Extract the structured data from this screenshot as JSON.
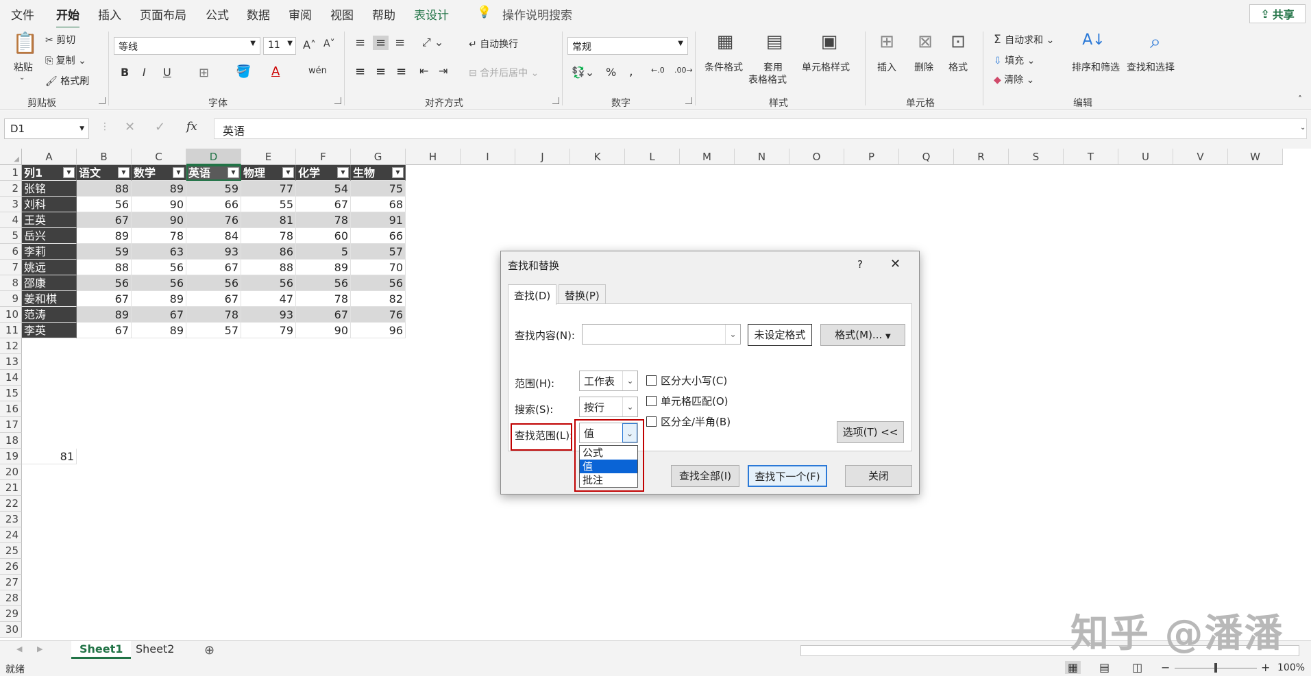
{
  "menu": {
    "tabs": [
      "文件",
      "开始",
      "插入",
      "页面布局",
      "公式",
      "数据",
      "审阅",
      "视图",
      "帮助",
      "表设计"
    ],
    "active_tab": "开始",
    "search": "操作说明搜索",
    "share": "共享"
  },
  "ribbon": {
    "clipboard": {
      "paste": "粘贴",
      "cut": "剪切",
      "copy": "复制",
      "format_painter": "格式刷",
      "label": "剪贴板"
    },
    "font": {
      "name": "等线",
      "size": "11",
      "bold": "B",
      "italic": "I",
      "underline": "U",
      "label": "字体"
    },
    "alignment": {
      "wrap": "自动换行",
      "merge": "合并后居中",
      "label": "对齐方式"
    },
    "number": {
      "format": "常规",
      "label": "数字"
    },
    "styles": {
      "conditional": "条件格式",
      "table_fmt_1": "套用",
      "table_fmt_2": "表格格式",
      "cell_styles": "单元格样式",
      "label": "样式"
    },
    "cells": {
      "insert": "插入",
      "delete": "删除",
      "format": "格式",
      "label": "单元格"
    },
    "editing": {
      "autosum": "自动求和",
      "fill": "填充",
      "clear": "清除",
      "sort": "排序和筛选",
      "find": "查找和选择",
      "label": "编辑"
    }
  },
  "formula_bar": {
    "name_box": "D1",
    "fx": "fx",
    "content": "英语"
  },
  "sheet": {
    "columns": [
      "A",
      "B",
      "C",
      "D",
      "E",
      "F",
      "G",
      "H",
      "I",
      "J",
      "K",
      "L",
      "M",
      "N",
      "O",
      "P",
      "Q",
      "R",
      "S",
      "T",
      "U",
      "V",
      "W"
    ],
    "selected_column": "D",
    "row_count": 30,
    "headers": [
      "列1",
      "语文",
      "数学",
      "英语",
      "物理",
      "化学",
      "生物"
    ],
    "rows": [
      [
        "张铭",
        "88",
        "89",
        "59",
        "77",
        "54",
        "75"
      ],
      [
        "刘科",
        "56",
        "90",
        "66",
        "55",
        "67",
        "68"
      ],
      [
        "王英",
        "67",
        "90",
        "76",
        "81",
        "78",
        "91"
      ],
      [
        "岳兴",
        "89",
        "78",
        "84",
        "78",
        "60",
        "66"
      ],
      [
        "李莉",
        "59",
        "63",
        "93",
        "86",
        "5",
        "57"
      ],
      [
        "姚远",
        "88",
        "56",
        "67",
        "88",
        "89",
        "70"
      ],
      [
        "邵康",
        "56",
        "56",
        "56",
        "56",
        "56",
        "56"
      ],
      [
        "姜和棋",
        "67",
        "89",
        "67",
        "47",
        "78",
        "82"
      ],
      [
        "范涛",
        "89",
        "67",
        "78",
        "93",
        "67",
        "76"
      ],
      [
        "李英",
        "67",
        "89",
        "57",
        "79",
        "90",
        "96"
      ]
    ],
    "extra_cell": {
      "ref": "A19",
      "value": "81"
    }
  },
  "sheet_tabs": [
    "Sheet1",
    "Sheet2"
  ],
  "active_sheet": "Sheet1",
  "status": {
    "ready": "就绪",
    "zoom": "100%"
  },
  "watermark": "知乎 @潘潘",
  "dialog": {
    "title": "查找和替换",
    "help": "?",
    "close_x": "✕",
    "tab_find": "查找(D)",
    "tab_replace": "替换(P)",
    "find_label": "查找内容(N):",
    "find_value": "",
    "no_format": "未设定格式",
    "format_btn": "格式(M)...",
    "scope_label": "范围(H):",
    "scope_value": "工作表",
    "search_label": "搜索(S):",
    "search_value": "按行",
    "lookin_label": "查找范围(L):",
    "lookin_value": "值",
    "lookin_options": [
      "公式",
      "值",
      "批注"
    ],
    "lookin_selected": "值",
    "match_case": "区分大小写(C)",
    "match_cell": "单元格匹配(O)",
    "match_width": "区分全/半角(B)",
    "options_btn": "选项(T) <<",
    "find_all": "查找全部(I)",
    "find_next": "查找下一个(F)",
    "close": "关闭"
  }
}
